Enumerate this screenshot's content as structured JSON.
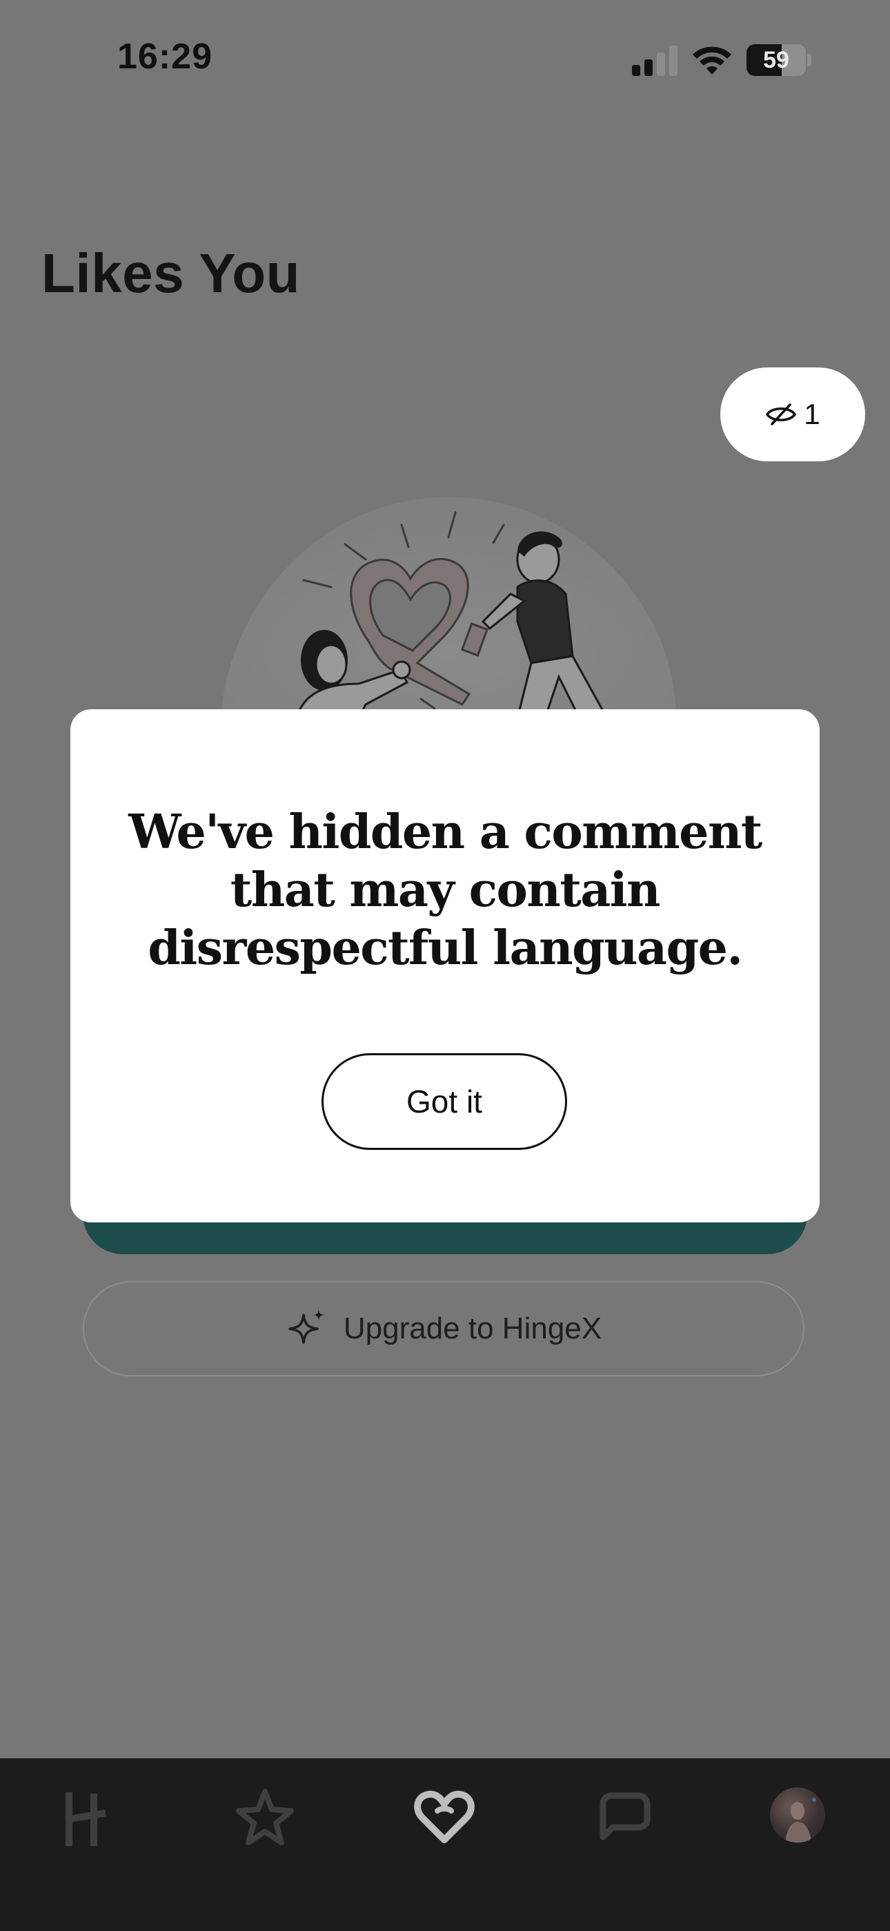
{
  "status_bar": {
    "time": "16:29",
    "battery": "59",
    "battery_level": 0.59
  },
  "page": {
    "title": "Likes You",
    "hidden_count": "1",
    "upgrade_label": "Upgrade to HingeX"
  },
  "modal": {
    "title": "We've hidden a comment that may contain disrespectful language.",
    "button_label": "Got it"
  },
  "colors": {
    "overlay": "#777777",
    "teal": "#1c4c4b",
    "tabbar": "#1c1c1c"
  },
  "tabs": [
    {
      "icon": "hinge-logo-icon"
    },
    {
      "icon": "star-icon"
    },
    {
      "icon": "heart-icon",
      "active": true
    },
    {
      "icon": "chat-icon"
    },
    {
      "icon": "profile-avatar"
    }
  ]
}
